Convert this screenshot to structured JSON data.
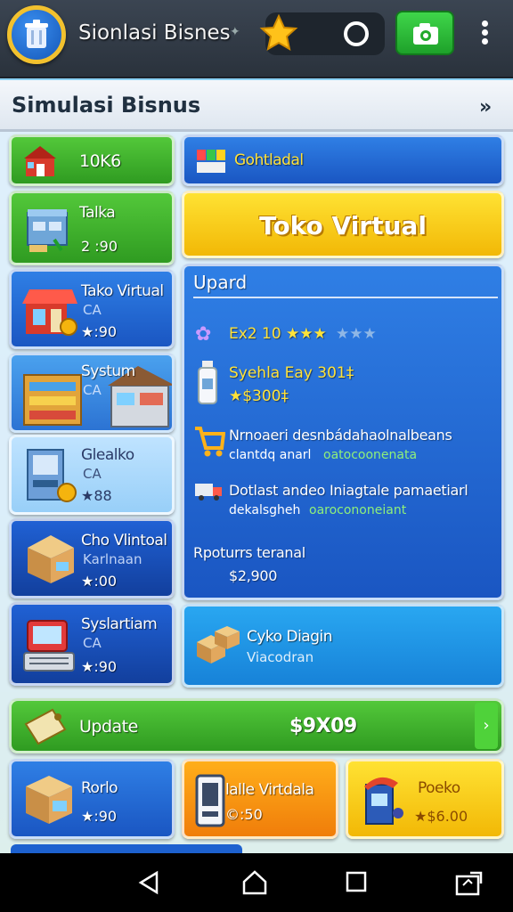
{
  "topbar": {
    "title": "Sionlasi Bisnes",
    "icons": [
      "trash-can-icon",
      "star-icon",
      "circle-icon",
      "camera-icon",
      "kebab-menu-icon"
    ]
  },
  "header": {
    "title": "Simulasi Bisnus"
  },
  "left_cards": [
    {
      "title": "10K6",
      "sub": "",
      "price": ""
    },
    {
      "title": "Talka",
      "sub": "",
      "price": "2 :90"
    },
    {
      "title": "Tako Virtual",
      "sub": "CA",
      "price": "★:90"
    },
    {
      "title": "Systum",
      "sub": "CA",
      "price": ""
    },
    {
      "title": "Glealko",
      "sub": "CA",
      "price": "★88"
    },
    {
      "title": "Cho Vlintoal",
      "sub": "Karlnaan",
      "price": "★:00"
    },
    {
      "title": "Syslartiam",
      "sub": "CA",
      "price": "★:90"
    }
  ],
  "top_right": {
    "label": "Gohtladal"
  },
  "big_yellow": {
    "label": "Toko Virtual"
  },
  "upgrade": {
    "title": "Upard",
    "row1": {
      "title": "Ex2 10 ★★★",
      "stars_dim": "★★★"
    },
    "row2": {
      "title": "Syehla Eay 301‡",
      "price": "★$300‡"
    },
    "row3": {
      "line1": "Nrnoaeri desnbádahaolnalbeans",
      "line2a": "clantdq anarl",
      "line2b": "oatocoonenata"
    },
    "row4": {
      "line1": "Dotlast andeo Iniagtale pamaetiarl",
      "line2a": "dekalsgheh",
      "line2b": "oarocononeiant"
    },
    "footer_label": "Rpoturrs teranal",
    "footer_price": "$2,900"
  },
  "city_card": {
    "title": "Cyko Diagin",
    "sub": "Viacodran"
  },
  "update_bar": {
    "label": "Update",
    "price": "$9X09"
  },
  "bottom_cards": [
    {
      "title": "Rorlo",
      "price": "★:90"
    },
    {
      "title": "lalle Virtdala",
      "price": "©:50"
    },
    {
      "title": "Poeko",
      "price": "★$6.00"
    }
  ],
  "navbar": {
    "icons": [
      "back-icon",
      "home-icon",
      "recents-icon",
      "screenshot-icon"
    ]
  },
  "colors": {
    "accent_green": "#2f9b21",
    "accent_blue": "#1a56c2",
    "accent_yellow": "#f2b806"
  }
}
